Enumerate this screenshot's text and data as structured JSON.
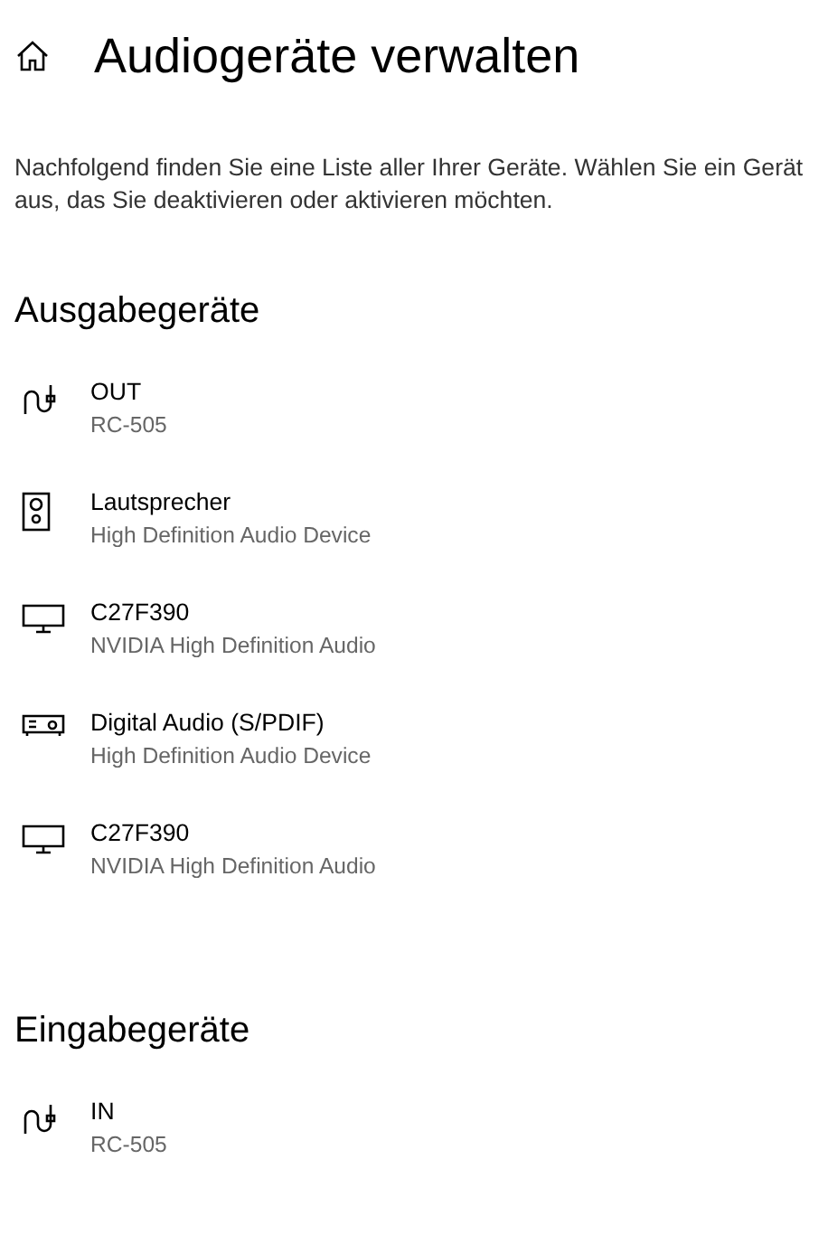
{
  "title": "Audiogeräte verwalten",
  "description": "Nachfolgend finden Sie eine Liste aller Ihrer Geräte. Wählen Sie ein Gerät aus, das Sie deaktivieren oder aktivieren möchten.",
  "sections": [
    {
      "heading": "Ausgabegeräte",
      "devices": [
        {
          "kind": "cable",
          "name": "OUT",
          "detail": "RC-505"
        },
        {
          "kind": "speaker",
          "name": "Lautsprecher",
          "detail": "High Definition Audio Device"
        },
        {
          "kind": "monitor",
          "name": "C27F390",
          "detail": "NVIDIA High Definition Audio"
        },
        {
          "kind": "spdif",
          "name": "Digital Audio (S/PDIF)",
          "detail": "High Definition Audio Device"
        },
        {
          "kind": "monitor",
          "name": "C27F390",
          "detail": "NVIDIA High Definition Audio"
        }
      ]
    },
    {
      "heading": "Eingabegeräte",
      "devices": [
        {
          "kind": "cable",
          "name": "IN",
          "detail": "RC-505"
        }
      ]
    }
  ]
}
